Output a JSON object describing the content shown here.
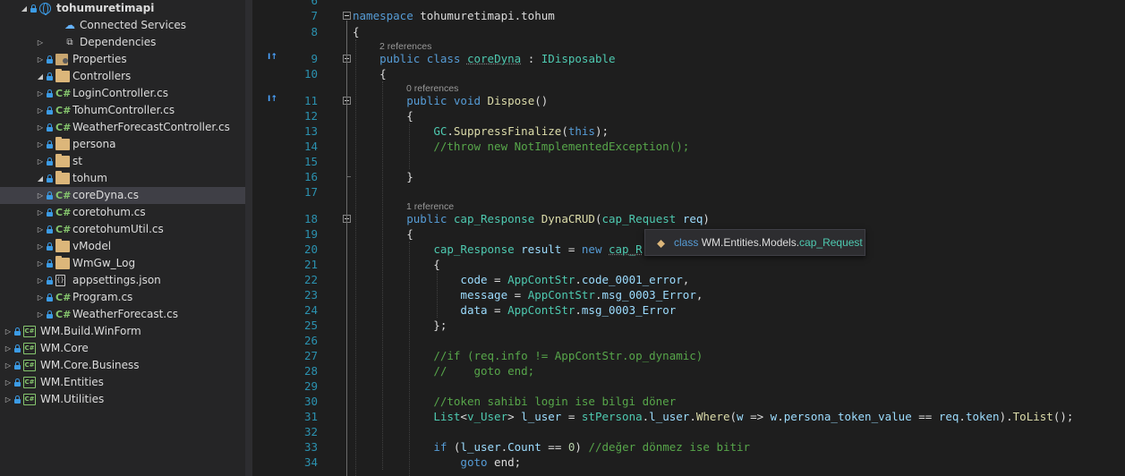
{
  "solution_explorer": {
    "items": [
      {
        "label": "tohumuretimapi",
        "icon": "web-project-icon",
        "expanded": true,
        "bold": true
      },
      {
        "label": "Connected Services",
        "icon": "cloud-icon"
      },
      {
        "label": "Dependencies",
        "icon": "dependencies-icon",
        "collapsed": true
      },
      {
        "label": "Properties",
        "icon": "properties-icon",
        "collapsed": true
      },
      {
        "label": "Controllers",
        "icon": "folder-icon",
        "expanded": true
      },
      {
        "label": "LoginController.cs",
        "icon": "csharp-file-icon",
        "collapsed": true
      },
      {
        "label": "TohumController.cs",
        "icon": "csharp-file-icon",
        "collapsed": true
      },
      {
        "label": "WeatherForecastController.cs",
        "icon": "csharp-file-icon",
        "collapsed": true
      },
      {
        "label": "persona",
        "icon": "folder-icon",
        "collapsed": true
      },
      {
        "label": "st",
        "icon": "folder-icon",
        "collapsed": true
      },
      {
        "label": "tohum",
        "icon": "folder-icon",
        "expanded": true
      },
      {
        "label": "coreDyna.cs",
        "icon": "csharp-file-icon",
        "collapsed": true,
        "selected": true
      },
      {
        "label": "coretohum.cs",
        "icon": "csharp-file-icon",
        "collapsed": true
      },
      {
        "label": "coretohumUtil.cs",
        "icon": "csharp-file-icon",
        "collapsed": true
      },
      {
        "label": "vModel",
        "icon": "folder-icon",
        "collapsed": true
      },
      {
        "label": "WmGw_Log",
        "icon": "folder-icon",
        "collapsed": true
      },
      {
        "label": "appsettings.json",
        "icon": "json-file-icon",
        "collapsed": true
      },
      {
        "label": "Program.cs",
        "icon": "csharp-file-icon",
        "collapsed": true
      },
      {
        "label": "WeatherForecast.cs",
        "icon": "csharp-file-icon",
        "collapsed": true
      },
      {
        "label": "WM.Build.WinForm",
        "icon": "csharp-project-icon",
        "collapsed": true
      },
      {
        "label": "WM.Core",
        "icon": "csharp-project-icon",
        "collapsed": true
      },
      {
        "label": "WM.Core.Business",
        "icon": "csharp-project-icon",
        "collapsed": true
      },
      {
        "label": "WM.Entities",
        "icon": "csharp-project-icon",
        "collapsed": true
      },
      {
        "label": "WM.Utilities",
        "icon": "csharp-project-icon",
        "collapsed": true
      }
    ]
  },
  "editor": {
    "line_numbers": [
      "6",
      "7",
      "8",
      "9",
      "10",
      "11",
      "12",
      "13",
      "14",
      "15",
      "16",
      "17",
      "18",
      "19",
      "20",
      "21",
      "22",
      "23",
      "24",
      "25",
      "26",
      "27",
      "28",
      "29",
      "30",
      "31",
      "32",
      "33",
      "34"
    ],
    "codelens": [
      "2 references",
      "0 references",
      "1 reference"
    ],
    "codelens_markers": [
      "I↑",
      "I↑"
    ],
    "lines": [
      [],
      [
        {
          "t": "namespace",
          "c": "kw"
        },
        {
          "t": " tohumuretimapi.tohum",
          "c": "tx"
        }
      ],
      [
        {
          "t": "{",
          "c": "tx"
        }
      ],
      [
        {
          "t": "    ",
          "c": "tx"
        },
        {
          "t": "public",
          "c": "kw"
        },
        {
          "t": " ",
          "c": "tx"
        },
        {
          "t": "class",
          "c": "kw"
        },
        {
          "t": " ",
          "c": "tx"
        },
        {
          "t": "coreDyna",
          "c": "ty squig"
        },
        {
          "t": " : ",
          "c": "tx"
        },
        {
          "t": "IDisposable",
          "c": "ty"
        }
      ],
      [
        {
          "t": "    {",
          "c": "tx"
        }
      ],
      [
        {
          "t": "        ",
          "c": "tx"
        },
        {
          "t": "public",
          "c": "kw"
        },
        {
          "t": " ",
          "c": "tx"
        },
        {
          "t": "void",
          "c": "kw"
        },
        {
          "t": " ",
          "c": "tx"
        },
        {
          "t": "Dispose",
          "c": "fn"
        },
        {
          "t": "()",
          "c": "tx"
        }
      ],
      [
        {
          "t": "        {",
          "c": "tx"
        }
      ],
      [
        {
          "t": "            ",
          "c": "tx"
        },
        {
          "t": "GC",
          "c": "ty"
        },
        {
          "t": ".",
          "c": "tx"
        },
        {
          "t": "SuppressFinalize",
          "c": "fn"
        },
        {
          "t": "(",
          "c": "tx"
        },
        {
          "t": "this",
          "c": "kw"
        },
        {
          "t": ");",
          "c": "tx"
        }
      ],
      [
        {
          "t": "            ",
          "c": "tx"
        },
        {
          "t": "//throw new NotImplementedException();",
          "c": "cm"
        }
      ],
      [],
      [
        {
          "t": "        }",
          "c": "tx"
        }
      ],
      [],
      [
        {
          "t": "        ",
          "c": "tx"
        },
        {
          "t": "public",
          "c": "kw"
        },
        {
          "t": " ",
          "c": "tx"
        },
        {
          "t": "cap_Response",
          "c": "ty"
        },
        {
          "t": " ",
          "c": "tx"
        },
        {
          "t": "DynaCRUD",
          "c": "fn"
        },
        {
          "t": "(",
          "c": "tx"
        },
        {
          "t": "cap_Request",
          "c": "ty"
        },
        {
          "t": " ",
          "c": "tx"
        },
        {
          "t": "req",
          "c": "va"
        },
        {
          "t": ")",
          "c": "tx"
        }
      ],
      [
        {
          "t": "        {",
          "c": "tx"
        }
      ],
      [
        {
          "t": "            ",
          "c": "tx"
        },
        {
          "t": "cap_Response",
          "c": "ty"
        },
        {
          "t": " ",
          "c": "tx"
        },
        {
          "t": "result",
          "c": "va"
        },
        {
          "t": " = ",
          "c": "tx"
        },
        {
          "t": "new",
          "c": "kw"
        },
        {
          "t": " ",
          "c": "tx"
        },
        {
          "t": "cap_R",
          "c": "ty squig"
        }
      ],
      [
        {
          "t": "            {",
          "c": "tx"
        }
      ],
      [
        {
          "t": "                ",
          "c": "tx"
        },
        {
          "t": "code",
          "c": "va"
        },
        {
          "t": " = ",
          "c": "tx"
        },
        {
          "t": "AppContStr",
          "c": "ty"
        },
        {
          "t": ".",
          "c": "tx"
        },
        {
          "t": "code_0001_error",
          "c": "va"
        },
        {
          "t": ",",
          "c": "tx"
        }
      ],
      [
        {
          "t": "                ",
          "c": "tx"
        },
        {
          "t": "message",
          "c": "va"
        },
        {
          "t": " = ",
          "c": "tx"
        },
        {
          "t": "AppContStr",
          "c": "ty"
        },
        {
          "t": ".",
          "c": "tx"
        },
        {
          "t": "msg_0003_Error",
          "c": "va"
        },
        {
          "t": ",",
          "c": "tx"
        }
      ],
      [
        {
          "t": "                ",
          "c": "tx"
        },
        {
          "t": "data",
          "c": "va"
        },
        {
          "t": " = ",
          "c": "tx"
        },
        {
          "t": "AppContStr",
          "c": "ty"
        },
        {
          "t": ".",
          "c": "tx"
        },
        {
          "t": "msg_0003_Error",
          "c": "va"
        }
      ],
      [
        {
          "t": "            };",
          "c": "tx"
        }
      ],
      [],
      [
        {
          "t": "            ",
          "c": "tx"
        },
        {
          "t": "//if (req.info != AppContStr.op_dynamic)",
          "c": "cm"
        }
      ],
      [
        {
          "t": "            ",
          "c": "tx"
        },
        {
          "t": "//    goto end;",
          "c": "cm"
        }
      ],
      [],
      [
        {
          "t": "            ",
          "c": "tx"
        },
        {
          "t": "//token sahibi login ise bilgi döner",
          "c": "cm"
        }
      ],
      [
        {
          "t": "            ",
          "c": "tx"
        },
        {
          "t": "List",
          "c": "ty"
        },
        {
          "t": "<",
          "c": "tx"
        },
        {
          "t": "v_User",
          "c": "ty"
        },
        {
          "t": "> ",
          "c": "tx"
        },
        {
          "t": "l_user",
          "c": "va"
        },
        {
          "t": " = ",
          "c": "tx"
        },
        {
          "t": "stPersona",
          "c": "ty"
        },
        {
          "t": ".",
          "c": "tx"
        },
        {
          "t": "l_user",
          "c": "va"
        },
        {
          "t": ".",
          "c": "tx"
        },
        {
          "t": "Where",
          "c": "fn"
        },
        {
          "t": "(",
          "c": "tx"
        },
        {
          "t": "w",
          "c": "va"
        },
        {
          "t": " => ",
          "c": "tx"
        },
        {
          "t": "w",
          "c": "va"
        },
        {
          "t": ".",
          "c": "tx"
        },
        {
          "t": "persona_token_value",
          "c": "va"
        },
        {
          "t": " == ",
          "c": "tx"
        },
        {
          "t": "req",
          "c": "va"
        },
        {
          "t": ".",
          "c": "tx"
        },
        {
          "t": "token",
          "c": "va"
        },
        {
          "t": ").",
          "c": "tx"
        },
        {
          "t": "ToList",
          "c": "fn"
        },
        {
          "t": "();",
          "c": "tx"
        }
      ],
      [],
      [
        {
          "t": "            ",
          "c": "tx"
        },
        {
          "t": "if",
          "c": "kw"
        },
        {
          "t": " (",
          "c": "tx"
        },
        {
          "t": "l_user",
          "c": "va"
        },
        {
          "t": ".",
          "c": "tx"
        },
        {
          "t": "Count",
          "c": "va"
        },
        {
          "t": " == ",
          "c": "tx"
        },
        {
          "t": "0",
          "c": "nu"
        },
        {
          "t": ") ",
          "c": "tx"
        },
        {
          "t": "//değer dönmez ise bitir",
          "c": "cm"
        }
      ],
      [
        {
          "t": "                ",
          "c": "tx"
        },
        {
          "t": "goto",
          "c": "kw"
        },
        {
          "t": " end;",
          "c": "tx"
        }
      ]
    ]
  },
  "tooltip": {
    "icon": "class-icon",
    "keyword": "class",
    "namespace": "WM.Entities.Models.",
    "type": "cap_Request",
    "colors": {
      "keyword": "#569cd6",
      "namespace": "#dcdcdc",
      "type": "#4ec9b0"
    }
  },
  "colors": {
    "editor_bg": "#1e1e1e",
    "explorer_bg": "#252526",
    "selected_row": "#3f3f46",
    "line_number": "#2b91af",
    "keyword": "#569cd6",
    "type": "#4ec9b0",
    "method": "#dcdcaa",
    "variable": "#9cdcfe",
    "comment": "#57a64a",
    "number": "#b5cea8"
  }
}
